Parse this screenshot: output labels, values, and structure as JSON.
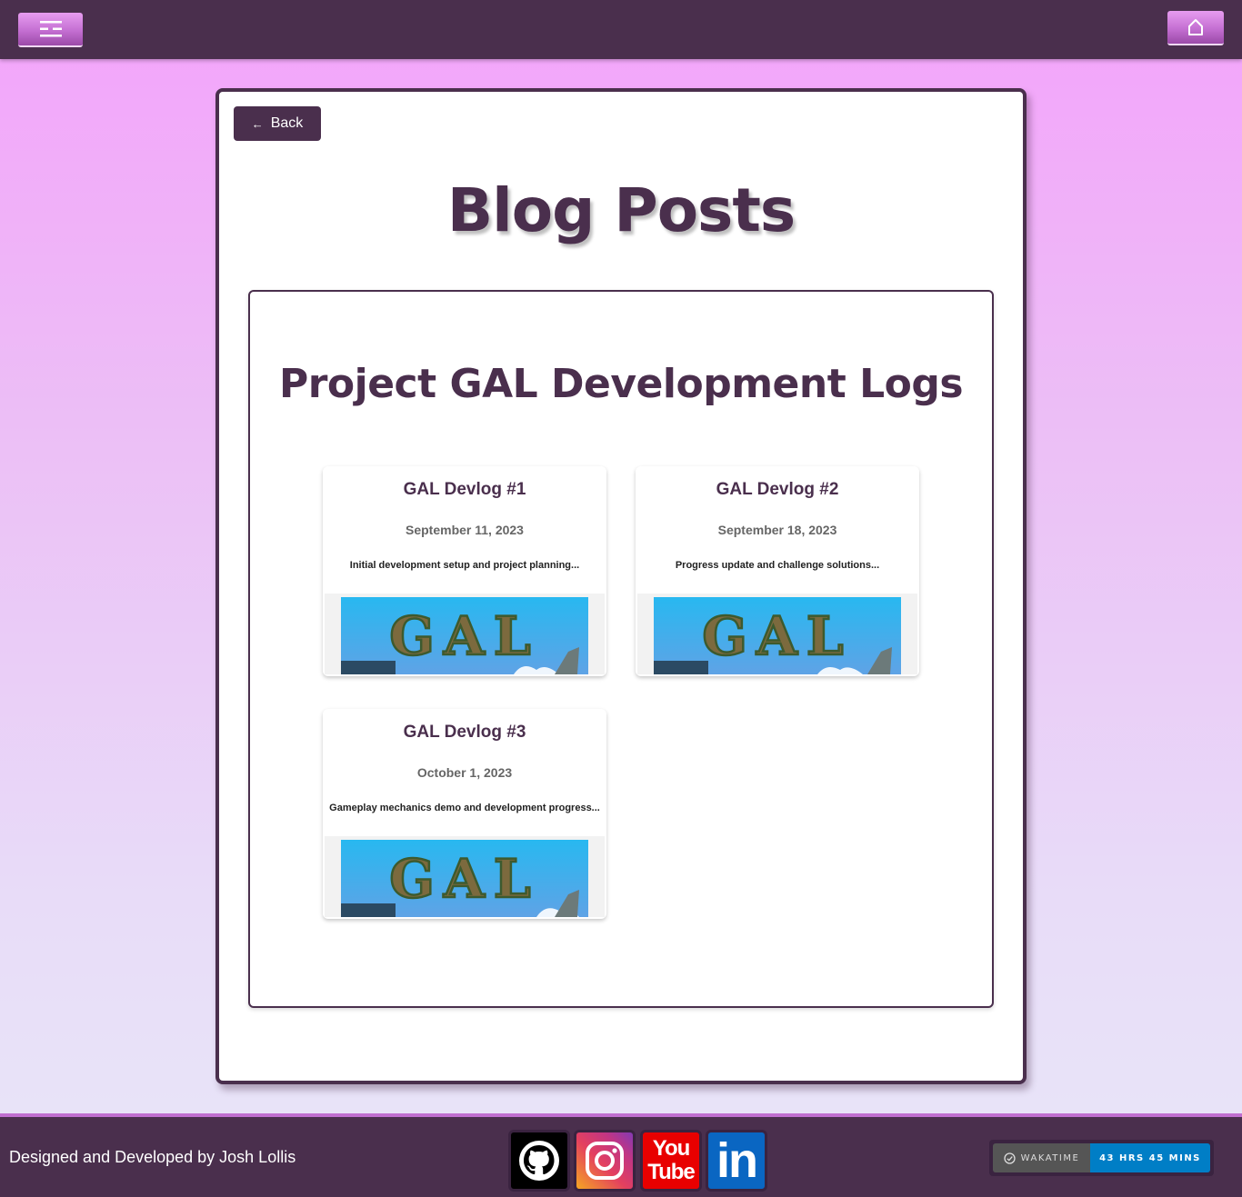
{
  "header": {
    "menu_icon": "menu-icon",
    "home_icon": "home-icon"
  },
  "main": {
    "back_label": "Back",
    "back_arrow": "←",
    "page_title": "Blog Posts",
    "section_title": "Project GAL Development Logs",
    "posts": [
      {
        "title": "GAL Devlog #1",
        "date": "September 11, 2023",
        "excerpt": "Initial development setup and project planning...",
        "thumbnail_text": "GAL"
      },
      {
        "title": "GAL Devlog #2",
        "date": "September 18, 2023",
        "excerpt": "Progress update and challenge solutions...",
        "thumbnail_text": "GAL"
      },
      {
        "title": "GAL Devlog #3",
        "date": "October 1, 2023",
        "excerpt": "Gameplay mechanics demo and development progress...",
        "thumbnail_text": "GAL"
      }
    ]
  },
  "footer": {
    "credit": "Designed and Developed by Josh Lollis",
    "social": [
      {
        "name": "github",
        "icon": "github-icon"
      },
      {
        "name": "instagram",
        "icon": "instagram-icon"
      },
      {
        "name": "youtube",
        "icon": "youtube-icon",
        "text_top": "You",
        "text_bottom": "Tube"
      },
      {
        "name": "linkedin",
        "icon": "linkedin-icon",
        "text": "in"
      }
    ],
    "wakatime": {
      "label": "WAKATIME",
      "value": "43 HRS 45 MINS"
    }
  },
  "colors": {
    "brand": "#4a2f4d",
    "accent": "#c46fd2",
    "wakatime_blue": "#007ec6"
  }
}
